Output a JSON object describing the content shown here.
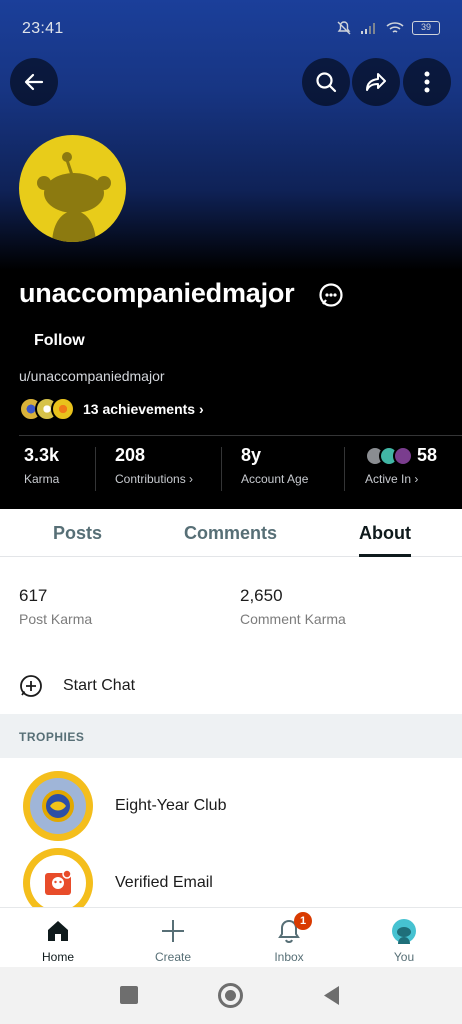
{
  "status_bar": {
    "time": "23:41",
    "battery": "39"
  },
  "profile": {
    "username": "unaccompaniedmajor",
    "follow_label": "Follow",
    "handle": "u/unaccompaniedmajor",
    "achievements_label": "13 achievements ›"
  },
  "stats": [
    {
      "value": "3.3k",
      "label": "Karma"
    },
    {
      "value": "208",
      "label": "Contributions ›"
    },
    {
      "value": "8y",
      "label": "Account Age"
    },
    {
      "value": "58",
      "label": "Active In ›"
    }
  ],
  "tabs": [
    "Posts",
    "Comments",
    "About"
  ],
  "active_tab": "About",
  "about": {
    "post_karma": {
      "value": "617",
      "label": "Post Karma"
    },
    "comment_karma": {
      "value": "2,650",
      "label": "Comment Karma"
    },
    "start_chat": "Start Chat",
    "trophies_header": "TROPHIES",
    "trophies": [
      {
        "label": "Eight-Year Club",
        "icon": "eight-year-club-icon"
      },
      {
        "label": "Verified Email",
        "icon": "verified-email-icon"
      }
    ]
  },
  "bottom_nav": [
    {
      "label": "Home",
      "icon": "home-icon"
    },
    {
      "label": "Create",
      "icon": "plus-icon"
    },
    {
      "label": "Inbox",
      "icon": "bell-icon",
      "badge": "1"
    },
    {
      "label": "You",
      "icon": "avatar-icon"
    }
  ],
  "colors": {
    "accent": "#d93a00",
    "avatar_yellow": "#e8cc1a",
    "header_blue": "#1b3f9a"
  }
}
